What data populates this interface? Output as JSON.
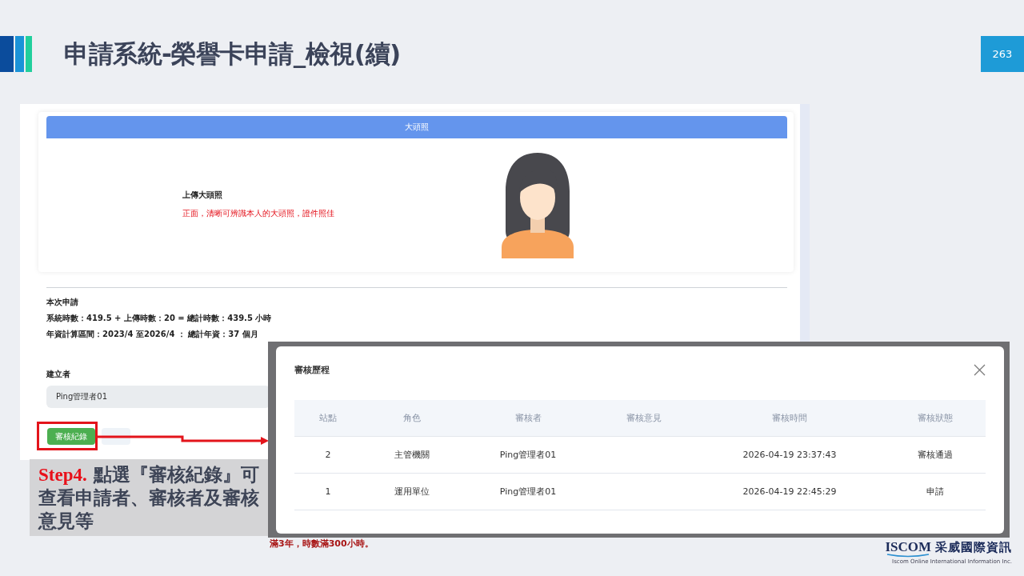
{
  "slide": {
    "title": "申請系統-榮譽卡申請_檢視(續)",
    "page_number": "263"
  },
  "photo_card": {
    "header": "大頭照",
    "upload_label": "上傳大頭照",
    "upload_hint": "正面，清晰可辨識本人的大頭照，證件照佳"
  },
  "application": {
    "heading": "本次申請",
    "hours_line": "系統時數：419.5 + 上傳時數：20 = 總計時數：**439.5** 小時",
    "seniority_line": "年資計算區間：2023/4 至2026/4 ： 總計年資：**37** 個月"
  },
  "creator": {
    "label": "建立者",
    "value": "Ping管理者01"
  },
  "buttons": [
    {
      "label": "審核紀錄",
      "kind": "primary"
    },
    {
      "kind": "secondary"
    }
  ],
  "callout": {
    "step": "Step4.",
    "text": "點選『審核紀錄』可查看申請者、審核者及審核意見等"
  },
  "modal": {
    "title": "審核歷程",
    "columns": [
      "站點",
      "角色",
      "審核者",
      "審核意見",
      "審核時間",
      "審核狀態"
    ],
    "rows": [
      {
        "station": "2",
        "role": "主管機關",
        "reviewer": "Ping管理者01",
        "review_time": "2026-04-19 23:37:43",
        "review_status": "審核通過"
      },
      {
        "station": "1",
        "role": "運用單位",
        "reviewer": "Ping管理者01",
        "review_time": "2026-04-19 22:45:29",
        "review_status": "申請"
      }
    ]
  },
  "background_note": "滿3年，時數滿300小時。",
  "logo": {
    "name": "ISCOM",
    "chinese_name": "采威國際資訊",
    "tagline": "Iscom Online International Information Inc."
  }
}
